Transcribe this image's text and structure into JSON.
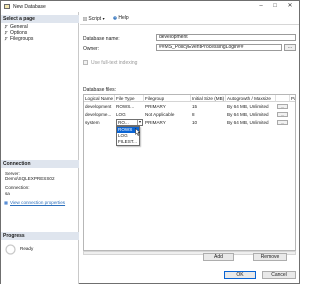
{
  "window": {
    "title": "New Database"
  },
  "left_panel": {
    "select_page_header": "Select a page",
    "pages": [
      {
        "label": "General",
        "icon": "wrench-icon"
      },
      {
        "label": "Options",
        "icon": "wrench-icon"
      },
      {
        "label": "Filegroups",
        "icon": "wrench-icon"
      }
    ],
    "connection_header": "Connection",
    "server_label": "Server:",
    "server_value": "Demo\\SQLEXPRESS02",
    "connection_label": "Connection:",
    "connection_value": "sa",
    "view_connection_link": "View connection properties",
    "progress_header": "Progress",
    "progress_status": "Ready"
  },
  "toolbar": {
    "script_label": "Script",
    "help_label": "Help"
  },
  "form": {
    "database_name_label": "Database name:",
    "database_name_value": "development",
    "owner_label": "Owner:",
    "owner_value": "##MS_PolicyEventProcessingLogin##",
    "owner_browse": "...",
    "fulltext_label": "Use full-text indexing",
    "database_files_label": "Database files:"
  },
  "grid": {
    "columns": [
      "Logical Name",
      "File Type",
      "Filegroup",
      "Initial Size (MB)",
      "Autogrowth / Maxsize",
      "",
      "Pa"
    ],
    "rows": [
      {
        "name": "development",
        "type": "ROWS...",
        "filegroup": "PRIMARY",
        "size": "15",
        "growth": "By 64 MB, Unlimited",
        "btn": "..."
      },
      {
        "name": "developme...",
        "type": "LOG",
        "filegroup": "Not Applicable",
        "size": "8",
        "growth": "By 64 MB, Unlimited",
        "btn": "..."
      },
      {
        "name": "system",
        "type": "RO...",
        "filegroup": "PRIMARY",
        "size": "10",
        "growth": "By 64 MB, Unlimited",
        "btn": "..."
      }
    ],
    "dropdown_options": [
      "ROWS",
      "LOG",
      "FILEST..."
    ]
  },
  "actions": {
    "add_label": "Add",
    "remove_label": "Remove",
    "ok_label": "OK",
    "cancel_label": "Cancel"
  },
  "colors": {
    "accent": "#0a64d4",
    "header_bg": "#dfe5ee",
    "link": "#2a6ebb"
  }
}
